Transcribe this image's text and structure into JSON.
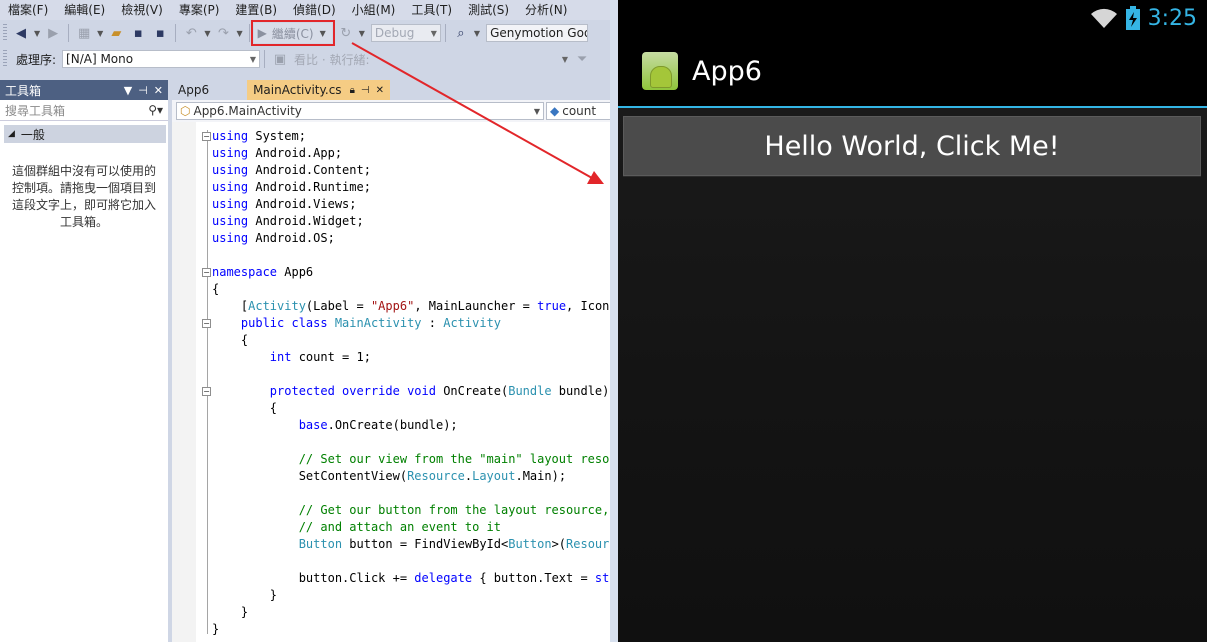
{
  "menu": [
    "檔案(F)",
    "編輯(E)",
    "檢視(V)",
    "專案(P)",
    "建置(B)",
    "偵錯(D)",
    "小組(M)",
    "工具(T)",
    "測試(S)",
    "分析(N)"
  ],
  "toolbar": {
    "continue_label": "繼續(C)",
    "config": "Debug",
    "device": "Genymotion Goo"
  },
  "toolbar2": {
    "process_label": "處理序:",
    "process_value": "[N/A] Mono",
    "stack_label": "看比 ·  執行緒:"
  },
  "toolbox": {
    "title": "工具箱",
    "search_placeholder": "搜尋工具箱",
    "group_label": "一般",
    "empty_text": "這個群組中沒有可以使用的控制項。請拖曳一個項目到這段文字上，即可將它加入工具箱。"
  },
  "editor": {
    "tabs": [
      "App6",
      "MainActivity.cs"
    ],
    "nav_left": "App6.MainActivity",
    "nav_right": "count"
  },
  "code": [
    [
      {
        "k": "kw",
        "t": "using"
      },
      {
        "k": "",
        "t": " System;"
      }
    ],
    [
      {
        "k": "kw",
        "t": "using"
      },
      {
        "k": "",
        "t": " Android.App;"
      }
    ],
    [
      {
        "k": "kw",
        "t": "using"
      },
      {
        "k": "",
        "t": " Android.Content;"
      }
    ],
    [
      {
        "k": "kw",
        "t": "using"
      },
      {
        "k": "",
        "t": " Android.Runtime;"
      }
    ],
    [
      {
        "k": "kw",
        "t": "using"
      },
      {
        "k": "",
        "t": " Android.Views;"
      }
    ],
    [
      {
        "k": "kw",
        "t": "using"
      },
      {
        "k": "",
        "t": " Android.Widget;"
      }
    ],
    [
      {
        "k": "kw",
        "t": "using"
      },
      {
        "k": "",
        "t": " Android.OS;"
      }
    ],
    [],
    [
      {
        "k": "kw",
        "t": "namespace"
      },
      {
        "k": "",
        "t": " App6"
      }
    ],
    [
      {
        "k": "",
        "t": "{"
      }
    ],
    [
      {
        "k": "",
        "t": "    ["
      },
      {
        "k": "ty",
        "t": "Activity"
      },
      {
        "k": "",
        "t": "(Label = "
      },
      {
        "k": "st",
        "t": "\"App6\""
      },
      {
        "k": "",
        "t": ", MainLauncher = "
      },
      {
        "k": "kw",
        "t": "true"
      },
      {
        "k": "",
        "t": ", Icon = "
      }
    ],
    [
      {
        "k": "kw",
        "t": "    public class "
      },
      {
        "k": "ty",
        "t": "MainActivity"
      },
      {
        "k": "",
        "t": " : "
      },
      {
        "k": "ty",
        "t": "Activity"
      }
    ],
    [
      {
        "k": "",
        "t": "    {"
      }
    ],
    [
      {
        "k": "kw",
        "t": "        int"
      },
      {
        "k": "",
        "t": " count = 1;"
      }
    ],
    [],
    [
      {
        "k": "kw",
        "t": "        protected override void"
      },
      {
        "k": "",
        "t": " OnCreate("
      },
      {
        "k": "ty",
        "t": "Bundle"
      },
      {
        "k": "",
        "t": " bundle)"
      }
    ],
    [
      {
        "k": "",
        "t": "        {"
      }
    ],
    [
      {
        "k": "kw",
        "t": "            base"
      },
      {
        "k": "",
        "t": ".OnCreate(bundle);"
      }
    ],
    [],
    [
      {
        "k": "cm",
        "t": "            // Set our view from the \"main\" layout resou"
      }
    ],
    [
      {
        "k": "",
        "t": "            SetContentView("
      },
      {
        "k": "ty",
        "t": "Resource"
      },
      {
        "k": "",
        "t": "."
      },
      {
        "k": "ty",
        "t": "Layout"
      },
      {
        "k": "",
        "t": ".Main);"
      }
    ],
    [],
    [
      {
        "k": "cm",
        "t": "            // Get our button from the layout resource,"
      }
    ],
    [
      {
        "k": "cm",
        "t": "            // and attach an event to it"
      }
    ],
    [
      {
        "k": "ty",
        "t": "            Button"
      },
      {
        "k": "",
        "t": " button = FindViewById<"
      },
      {
        "k": "ty",
        "t": "Button"
      },
      {
        "k": "",
        "t": ">("
      },
      {
        "k": "ty",
        "t": "Resource"
      }
    ],
    [],
    [
      {
        "k": "",
        "t": "            button.Click += "
      },
      {
        "k": "kw",
        "t": "delegate"
      },
      {
        "k": "",
        "t": " { button.Text = "
      },
      {
        "k": "kw",
        "t": "stri"
      }
    ],
    [
      {
        "k": "",
        "t": "        }"
      }
    ],
    [
      {
        "k": "",
        "t": "    }"
      }
    ],
    [
      {
        "k": "",
        "t": "}"
      }
    ]
  ],
  "android": {
    "clock": "3:25",
    "app_title": "App6",
    "button_label": "Hello World, Click Me!"
  },
  "colors": {
    "accent": "#33b5e5",
    "annotation": "#e2262a",
    "active_tab": "#f5cc84"
  }
}
